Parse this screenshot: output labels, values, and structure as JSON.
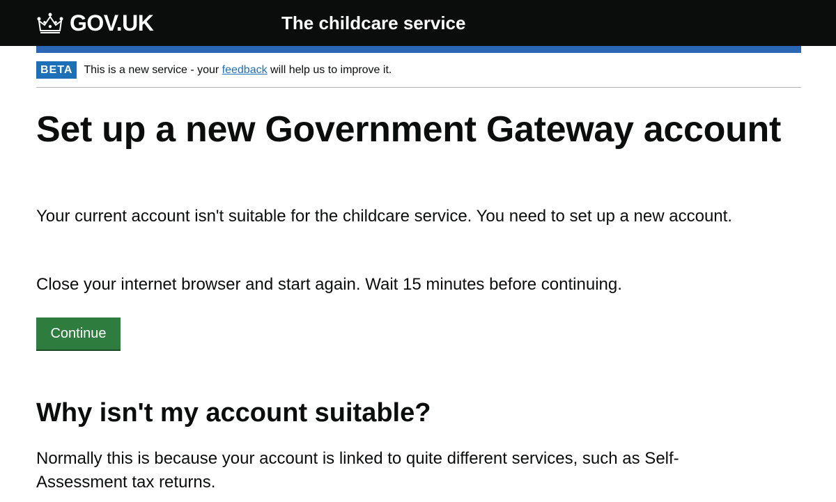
{
  "header": {
    "logo_text": "GOV.UK",
    "service_name": "The childcare service"
  },
  "phase_banner": {
    "tag": "BETA",
    "text_before": "This is a new service - your ",
    "link_text": "feedback",
    "text_after": " will help us to improve it."
  },
  "main": {
    "heading": "Set up a new Government Gateway account",
    "paragraph_1": "Your current account isn't suitable for the childcare service. You need to set up a new account.",
    "paragraph_2": "Close your internet browser and start again. Wait 15 minutes before continuing.",
    "continue_label": "Continue",
    "subheading": "Why isn't my account suitable?",
    "paragraph_3": "Normally this is because your account is linked to quite different services, such as Self-Assessment tax returns."
  },
  "colors": {
    "header_bg": "#0b0c0c",
    "accent_bar": "#2b66b4",
    "beta_tag_bg": "#1d70b8",
    "link": "#1d70b8",
    "button_bg": "#2e7d3e"
  },
  "icons": {
    "logo_icon": "crown-icon"
  }
}
